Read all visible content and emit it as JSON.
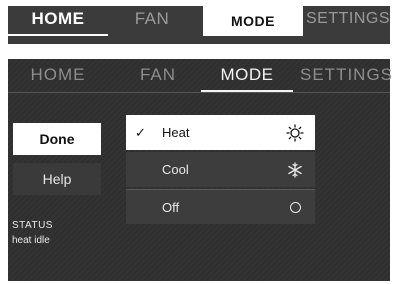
{
  "top_tabs": {
    "home": "HOME",
    "fan": "FAN",
    "mode": "MODE",
    "settings": "SETTINGS"
  },
  "screen": {
    "tabs": {
      "home": "HOME",
      "fan": "FAN",
      "mode": "MODE",
      "settings": "SETTINGS",
      "active": "MODE"
    },
    "buttons": {
      "done": "Done",
      "help": "Help"
    },
    "status": {
      "label": "STATUS",
      "value": "heat idle"
    },
    "modes": [
      {
        "label": "Heat",
        "icon": "sun-icon",
        "selected": true,
        "check": "✓"
      },
      {
        "label": "Cool",
        "icon": "snowflake-icon",
        "selected": false
      },
      {
        "label": "Off",
        "icon": "circle-icon",
        "selected": false
      }
    ]
  },
  "colors": {
    "screen_bg": "#2f2f2f",
    "selected_bg": "#ffffff",
    "text_light": "#e8e8e8",
    "tab_inactive": "#8d8d8d"
  }
}
